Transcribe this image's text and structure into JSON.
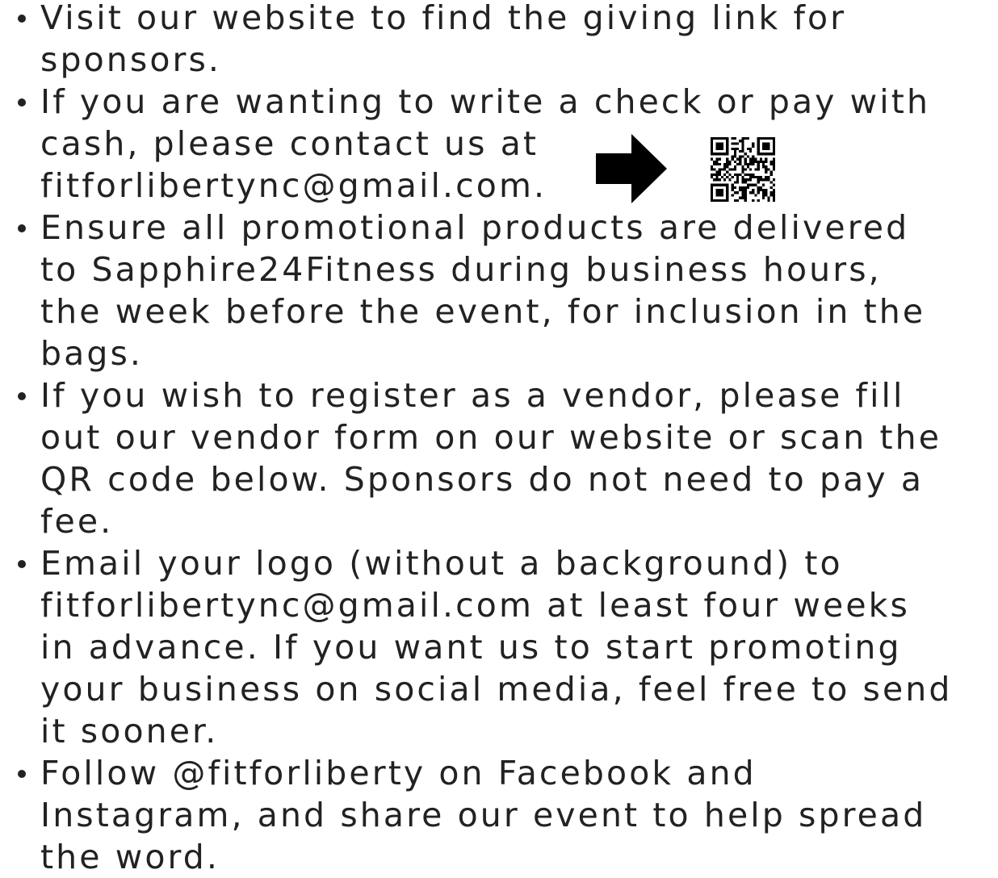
{
  "bullets": [
    {
      "lines": [
        "Visit our website to find the giving link for",
        "sponsors."
      ]
    },
    {
      "lines": [
        "If you are wanting to write a check or pay with",
        "cash, please contact us at",
        "fitforlibertync@gmail.com."
      ]
    },
    {
      "lines": [
        "Ensure all promotional products are delivered",
        "to Sapphire24Fitness during business hours,",
        "the week before the event, for inclusion in the",
        "bags."
      ]
    },
    {
      "lines": [
        "If you wish to register as a vendor, please fill",
        "out our vendor form on our website or scan the",
        "QR code below. Sponsors do not need to pay a",
        "fee."
      ]
    },
    {
      "lines": [
        "Email your logo (without a background) to",
        "fitforlibertync@gmail.com at least four weeks",
        "in advance. If you want us to start promoting",
        "your business on social media, feel free to send",
        "it sooner."
      ]
    },
    {
      "lines": [
        "Follow @fitforliberty on Facebook and",
        "Instagram, and share our event to help spread",
        "the word."
      ]
    }
  ],
  "icons": {
    "arrow": "arrow-right-icon",
    "qr": "qr-code-icon"
  },
  "colors": {
    "text": "#222222",
    "background": "#ffffff",
    "icon": "#000000"
  }
}
